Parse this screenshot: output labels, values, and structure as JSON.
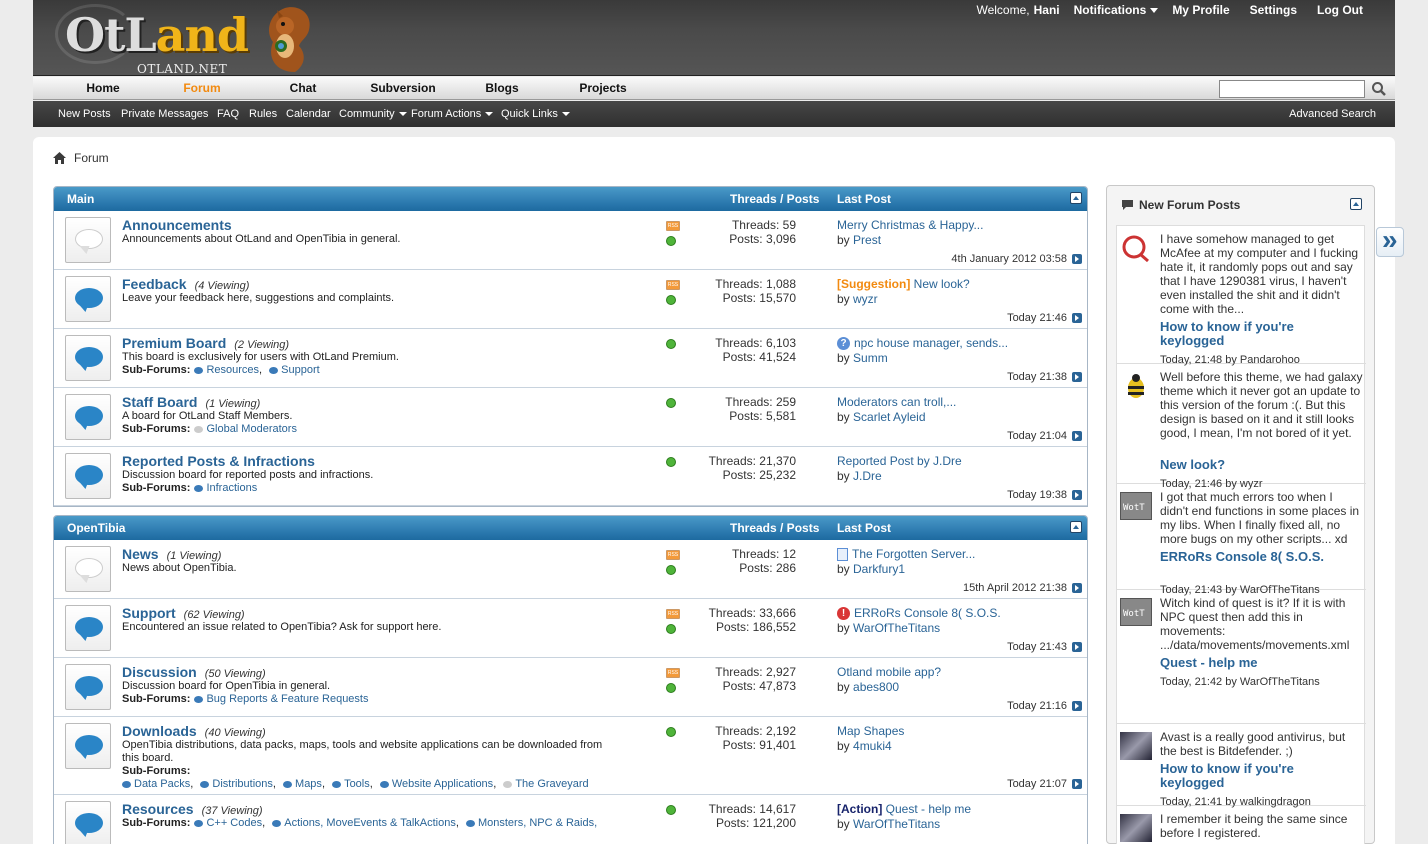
{
  "header": {
    "logo_text_a": "OtL",
    "logo_text_b": "and",
    "logo_sub": "OTLAND.NET",
    "welcome": "Welcome,",
    "username": "Hani",
    "notifications": "Notifications",
    "profile": "My Profile",
    "settings": "Settings",
    "logout": "Log Out"
  },
  "tabs": [
    "Home",
    "Forum",
    "Chat",
    "Subversion",
    "Blogs",
    "Projects"
  ],
  "active_tab": "Forum",
  "subnav": {
    "items": [
      "New Posts",
      "Private Messages",
      "FAQ",
      "Rules",
      "Calendar",
      "Community",
      "Forum Actions",
      "Quick Links"
    ],
    "advanced": "Advanced Search"
  },
  "breadcrumb": "Forum",
  "block_headers": {
    "threads_posts": "Threads / Posts",
    "last_post": "Last Post"
  },
  "main": {
    "title": "Main",
    "forums": [
      {
        "name": "Announcements",
        "viewing": "",
        "desc": "Announcements about OtLand and OpenTibia in general.",
        "sub_label": "",
        "subs": [],
        "threads": "Threads: 59",
        "posts": "Posts: 3,096",
        "prefix": "",
        "last_title": "Merry Christmas & Happy...",
        "by": "by",
        "last_user": "Prest",
        "time": "4th January 2012 03:58",
        "icon": "grey",
        "rss": true
      },
      {
        "name": "Feedback",
        "viewing": "(4 Viewing)",
        "desc": "Leave your feedback here, suggestions and complaints.",
        "sub_label": "",
        "subs": [],
        "threads": "Threads: 1,088",
        "posts": "Posts: 15,570",
        "prefix": "[Suggestion]",
        "last_title": "New look?",
        "by": "by",
        "last_user": "wyzr",
        "time": "Today 21:46",
        "icon": "blue",
        "rss": true
      },
      {
        "name": "Premium Board",
        "viewing": "(2 Viewing)",
        "desc": "This board is exclusively for users with OtLand Premium.",
        "sub_label": "Sub-Forums:",
        "subs": [
          "Resources",
          "Support"
        ],
        "threads": "Threads: 6,103",
        "posts": "Posts: 41,524",
        "prefix": "",
        "last_title": "npc house manager, sends...",
        "by": "by",
        "last_user": "Summ",
        "time": "Today 21:38",
        "icon": "blue",
        "rss": false
      },
      {
        "name": "Staff Board",
        "viewing": "(1 Viewing)",
        "desc": "A board for OtLand Staff Members.",
        "sub_label": "Sub-Forums:",
        "subs": [
          "Global Moderators"
        ],
        "threads": "Threads: 259",
        "posts": "Posts: 5,581",
        "prefix": "",
        "last_title": "Moderators can troll,...",
        "by": "by",
        "last_user": "Scarlet Ayleid",
        "time": "Today 21:04",
        "icon": "blue",
        "rss": false
      },
      {
        "name": "Reported Posts & Infractions",
        "viewing": "",
        "desc": "Discussion board for reported posts and infractions.",
        "sub_label": "Sub-Forums:",
        "subs": [
          "Infractions"
        ],
        "threads": "Threads: 21,370",
        "posts": "Posts: 25,232",
        "prefix": "",
        "last_title": "Reported Post by J.Dre",
        "by": "by",
        "last_user": "J.Dre",
        "time": "Today 19:38",
        "icon": "blue",
        "rss": false
      }
    ]
  },
  "opentibia": {
    "title": "OpenTibia",
    "forums": [
      {
        "name": "News",
        "viewing": "(1 Viewing)",
        "desc": "News about OpenTibia.",
        "sub_label": "",
        "subs": [],
        "threads": "Threads: 12",
        "posts": "Posts: 286",
        "prefix": "",
        "last_title": "The Forgotten Server...",
        "by": "by",
        "last_user": "Darkfury1",
        "time": "15th April 2012 21:38",
        "icon": "grey",
        "rss": true
      },
      {
        "name": "Support",
        "viewing": "(62 Viewing)",
        "desc": "Encountered an issue related to OpenTibia? Ask for support here.",
        "sub_label": "",
        "subs": [],
        "threads": "Threads: 33,666",
        "posts": "Posts: 186,552",
        "prefix": "",
        "last_title": "ERRoRs Console 8( S.O.S.",
        "by": "by",
        "last_user": "WarOfTheTitans",
        "time": "Today 21:43",
        "icon": "blue",
        "rss": true
      },
      {
        "name": "Discussion",
        "viewing": "(50 Viewing)",
        "desc": "Discussion board for OpenTibia in general.",
        "sub_label": "Sub-Forums:",
        "subs": [
          "Bug Reports & Feature Requests"
        ],
        "threads": "Threads: 2,927",
        "posts": "Posts: 47,873",
        "prefix": "",
        "last_title": "Otland mobile app?",
        "by": "by",
        "last_user": "abes800",
        "time": "Today 21:16",
        "icon": "blue",
        "rss": true
      },
      {
        "name": "Downloads",
        "viewing": "(40 Viewing)",
        "desc": "OpenTibia distributions, data packs, maps, tools and website applications can be downloaded from this board.",
        "sub_label": "Sub-Forums:",
        "subs": [
          "Data Packs",
          "Distributions",
          "Maps",
          "Tools",
          "Website Applications",
          "The Graveyard"
        ],
        "threads": "Threads: 2,192",
        "posts": "Posts: 91,401",
        "prefix": "",
        "last_title": "Map Shapes",
        "by": "by",
        "last_user": "4muki4",
        "time": "Today 21:07",
        "icon": "blue",
        "rss": false
      },
      {
        "name": "Resources",
        "viewing": "(37 Viewing)",
        "desc": "",
        "sub_label": "Sub-Forums:",
        "subs": [
          "C++ Codes",
          "Actions, MoveEvents & TalkActions",
          "Monsters, NPC & Raids,"
        ],
        "threads": "Threads: 14,617",
        "posts": "Posts: 121,200",
        "prefix": "[Action]",
        "last_title": "Quest - help me",
        "by": "by",
        "last_user": "WarOfTheTitans",
        "time": "",
        "icon": "blue",
        "rss": false
      }
    ]
  },
  "sidebar": {
    "title": "New Forum Posts",
    "posts": [
      {
        "text": "I have somehow managed to get McAfee at my computer and I fucking hate it, it randomly pops out and say that I have 1290381 virus, I haven't even installed the shit and it didn't come with the...",
        "title": "How to know if you're keylogged",
        "meta": "Today, 21:48 by Pandarohoo"
      },
      {
        "text": "Well before this theme, we had galaxy theme which it never got an update to this version of the forum :(. But this design is based on it and it still looks good, I mean, I'm not bored of it yet.",
        "title": "New look?",
        "meta": "Today, 21:46 by wyzr"
      },
      {
        "text": "I got that much errors too when I didn't end functions in some places in my libs. When I finally fixed all, no more bugs on my other scripts... xd",
        "title": "ERRoRs Console 8( S.O.S.",
        "meta": "Today, 21:43 by WarOfTheTitans"
      },
      {
        "text": "Witch kind of quest is it? If it is with NPC quest then add this in movements: .../data/movements/movements.xml .../data/movements/scripts/dquest.lua function onStepIn(cid, item,...",
        "title": "Quest - help me",
        "meta": "Today, 21:42 by WarOfTheTitans"
      },
      {
        "text": "Avast is a really good antivirus, but the best is Bitdefender. ;)",
        "title": "How to know if you're keylogged",
        "meta": "Today, 21:41 by walkingdragon"
      },
      {
        "text": "I remember it being the same since before I registered.",
        "title": "",
        "meta": ""
      }
    ]
  }
}
